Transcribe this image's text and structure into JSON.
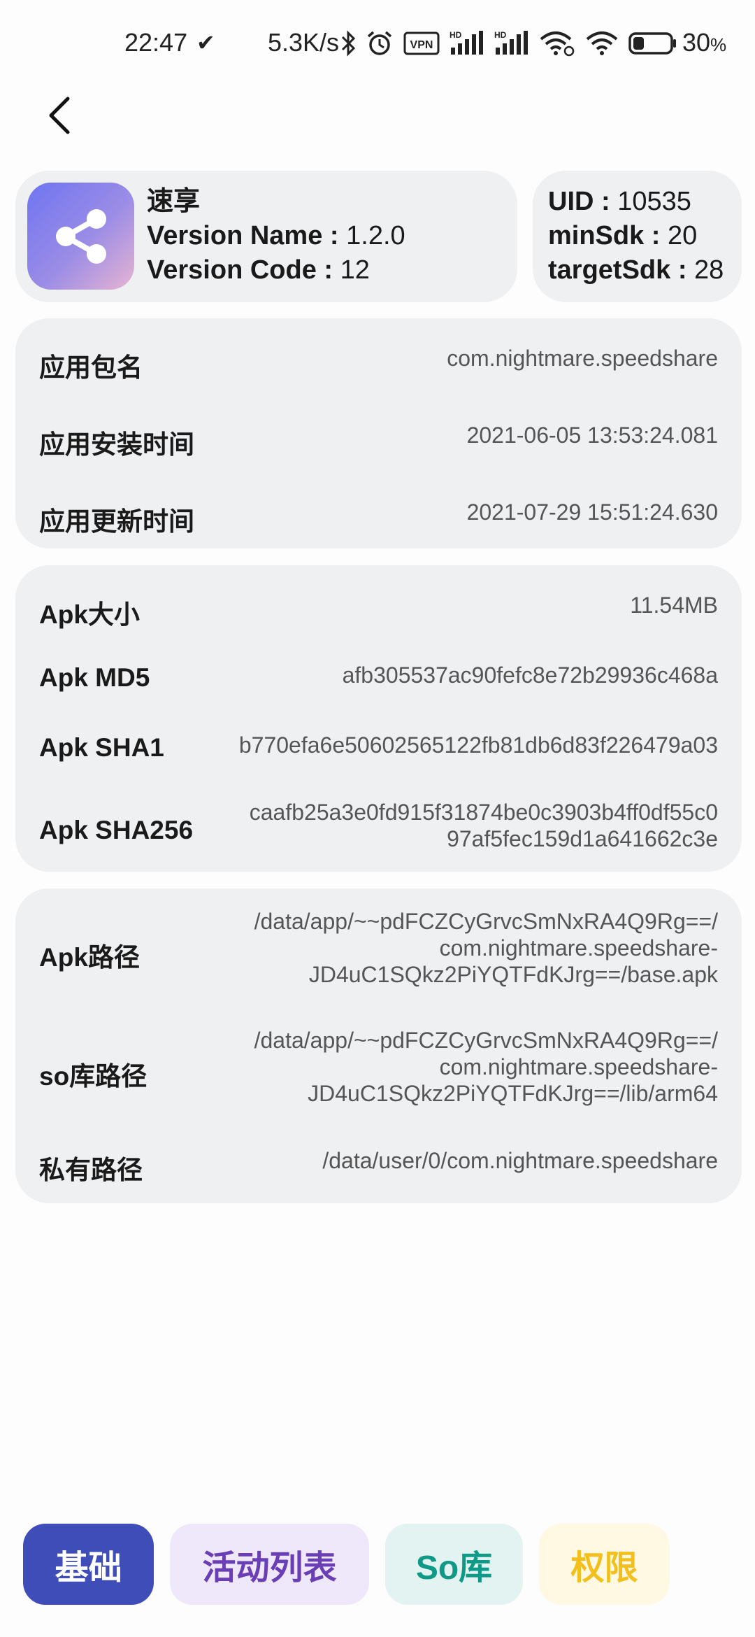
{
  "status_bar": {
    "time": "22:47",
    "net_speed": "5.3K/s",
    "battery_percent": "30",
    "battery_unit": "%",
    "battery_level": 0.3,
    "icons": [
      "bluetooth-icon",
      "alarm-icon",
      "vpn-icon",
      "hd-signal-icon",
      "hd-signal-icon",
      "wifi-link-icon",
      "wifi-icon",
      "battery-icon"
    ]
  },
  "header": {
    "back_icon": "chevron-left-icon"
  },
  "app_card": {
    "name": "速享",
    "version_name_label": "Version Name : ",
    "version_name": "1.2.0",
    "version_code_label": "Version Code : ",
    "version_code": "12",
    "icon": "share-icon"
  },
  "uid_card": {
    "uid_label": "UID : ",
    "uid": "10535",
    "min_sdk_label": "minSdk : ",
    "min_sdk": "20",
    "target_sdk_label": "targetSdk : ",
    "target_sdk": "28"
  },
  "package_card": {
    "rows": [
      {
        "label": "应用包名",
        "value": "com.nightmare.speedshare"
      },
      {
        "label": "应用安装时间",
        "value": "2021-06-05 13:53:24.081"
      },
      {
        "label": "应用更新时间",
        "value": "2021-07-29 15:51:24.630"
      }
    ]
  },
  "apk_card": {
    "rows": [
      {
        "label": "Apk大小",
        "value": "11.54MB"
      },
      {
        "label": "Apk MD5",
        "value": "afb305537ac90fefc8e72b29936c468a"
      },
      {
        "label": "Apk SHA1",
        "value": "b770efa6e50602565122fb81db6d83f226479a03"
      },
      {
        "label": "Apk SHA256",
        "value": "caafb25a3e0fd915f31874be0c3903b4ff0df55c0\n97af5fec159d1a641662c3e"
      }
    ]
  },
  "path_card": {
    "rows": [
      {
        "label": "Apk路径",
        "value": "/data/app/~~pdFCZCyGrvcSmNxRA4Q9Rg==/\ncom.nightmare.speedshare-\nJD4uC1SQkz2PiYQTFdKJrg==/base.apk"
      },
      {
        "label": "so库路径",
        "value": "/data/app/~~pdFCZCyGrvcSmNxRA4Q9Rg==/\ncom.nightmare.speedshare-\nJD4uC1SQkz2PiYQTFdKJrg==/lib/arm64"
      },
      {
        "label": "私有路径",
        "value": "/data/user/0/com.nightmare.speedshare"
      }
    ]
  },
  "bottom_tabs": [
    {
      "label": "基础",
      "bg": "#3F4DB8",
      "fg": "#FFFFFF",
      "active": true
    },
    {
      "label": "活动列表",
      "bg": "#EEE8FA",
      "fg": "#6A3FB5",
      "active": false
    },
    {
      "label": "So库",
      "bg": "#E2F3F1",
      "fg": "#0E9A86",
      "active": false
    },
    {
      "label": "权限",
      "bg": "#FFF8E3",
      "fg": "#F2BF1D",
      "active": false
    }
  ]
}
